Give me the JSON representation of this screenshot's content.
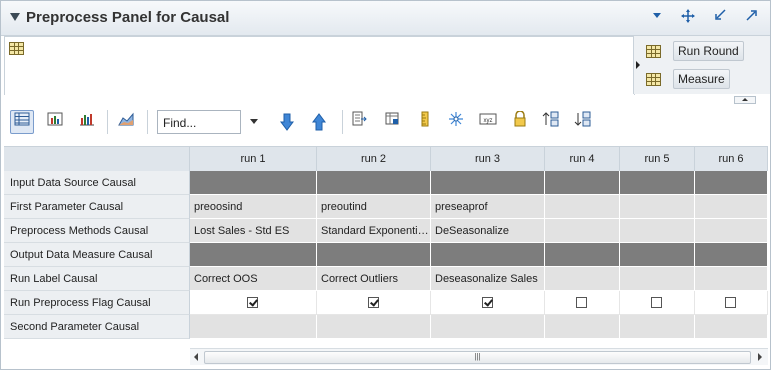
{
  "panel": {
    "title": "Preprocess Panel for Causal"
  },
  "header_icons": [
    "chevron-down-icon",
    "move-icon",
    "restore-icon",
    "maximize-icon"
  ],
  "top_right": {
    "items": [
      {
        "label": "Run Round"
      },
      {
        "label": "Measure"
      }
    ]
  },
  "toolbar": {
    "find_placeholder": "Find...",
    "buttons": [
      "table-view-icon",
      "chart-view-icon",
      "bar-chart-icon",
      "area-chart-icon",
      "find-next-icon",
      "find-previous-icon",
      "export-icon",
      "edit-icon",
      "ruler-icon",
      "sparkle-icon",
      "xyz-icon",
      "lock-icon",
      "sort-ascending-icon",
      "sort-descending-icon"
    ]
  },
  "table": {
    "columns": [
      "run 1",
      "run 2",
      "run 3",
      "run 4",
      "run 5",
      "run 6"
    ],
    "rows": [
      {
        "label": "Input Data Source Causal",
        "style": "dark",
        "cells": [
          "",
          "",
          "",
          "",
          "",
          ""
        ]
      },
      {
        "label": "First Parameter Causal",
        "style": "light",
        "cells": [
          "preoosind",
          "preoutind",
          "preseaprof",
          "",
          "",
          ""
        ]
      },
      {
        "label": "Preprocess Methods Causal",
        "style": "light",
        "cells": [
          "Lost Sales - Std ES",
          "Standard Exponenti…",
          "DeSeasonalize",
          "",
          "",
          ""
        ]
      },
      {
        "label": "Output Data Measure Causal",
        "style": "dark",
        "cells": [
          "",
          "",
          "",
          "",
          "",
          ""
        ]
      },
      {
        "label": "Run Label Causal",
        "style": "light",
        "cells": [
          "Correct OOS",
          "Correct Outliers",
          "Deseasonalize Sales",
          "",
          "",
          ""
        ]
      },
      {
        "label": "Run Preprocess Flag Causal",
        "style": "checkbox",
        "checked": [
          true,
          true,
          true,
          false,
          false,
          false
        ]
      },
      {
        "label": "Second Parameter Causal",
        "style": "light",
        "cells": [
          "",
          "",
          "",
          "",
          "",
          ""
        ]
      }
    ]
  },
  "scrollbar": {
    "grip": "|||"
  }
}
